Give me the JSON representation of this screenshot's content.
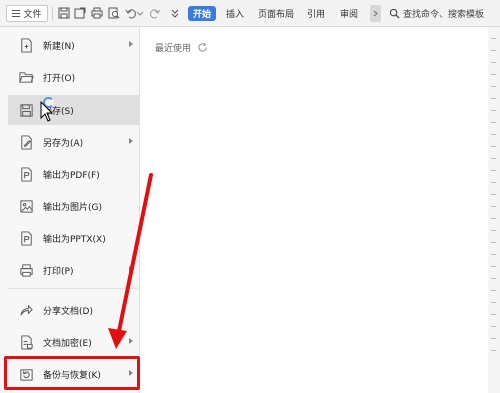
{
  "toolbar": {
    "file_label": "文件",
    "start_tab": "开始",
    "tabs": [
      "插入",
      "页面布局",
      "引用",
      "审阅"
    ],
    "search_placeholder": "查找命令、搜索模板"
  },
  "menu": {
    "items": [
      {
        "label": "新建(N)",
        "icon": "new-doc-icon",
        "has_submenu": true
      },
      {
        "label": "打开(O)",
        "icon": "folder-open-icon",
        "has_submenu": false
      },
      {
        "label": "保存(S)",
        "icon": "save-icon",
        "has_submenu": false
      },
      {
        "label": "另存为(A)",
        "icon": "save-as-icon",
        "has_submenu": true
      },
      {
        "label": "输出为PDF(F)",
        "icon": "pdf-export-icon",
        "has_submenu": false
      },
      {
        "label": "输出为图片(G)",
        "icon": "image-export-icon",
        "has_submenu": false
      },
      {
        "label": "输出为PPTX(X)",
        "icon": "pptx-export-icon",
        "has_submenu": false
      },
      {
        "label": "打印(P)",
        "icon": "printer-icon",
        "has_submenu": true
      },
      {
        "label": "分享文档(D)",
        "icon": "share-icon",
        "has_submenu": false
      },
      {
        "label": "文档加密(E)",
        "icon": "encrypt-icon",
        "has_submenu": true
      },
      {
        "label": "备份与恢复(K)",
        "icon": "backup-restore-icon",
        "has_submenu": true
      }
    ]
  },
  "recent": {
    "label": "最近使用"
  },
  "colors": {
    "accent": "#3b7be0",
    "highlight": "#e01010",
    "menu_bg": "#f7f7f7",
    "hover_bg": "#dfdfdf"
  }
}
